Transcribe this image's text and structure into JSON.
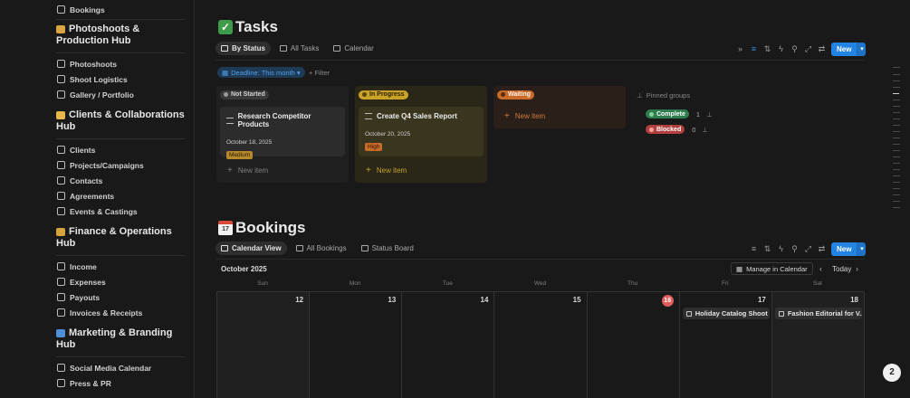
{
  "sidebar": {
    "top_item": "Bookings",
    "hubs": [
      {
        "title": "Photoshoots & Production Hub",
        "icon": "camera-emoji-icon",
        "color": "#d9a441",
        "items": [
          "Photoshoots",
          "Shoot Logistics",
          "Gallery / Portfolio"
        ]
      },
      {
        "title": "Clients & Collaborations Hub",
        "icon": "handshake-emoji-icon",
        "color": "#e6b84c",
        "items": [
          "Clients",
          "Projects/Campaigns",
          "Contacts",
          "Agreements",
          "Events & Castings"
        ]
      },
      {
        "title": "Finance & Operations Hub",
        "icon": "money-bag-emoji-icon",
        "color": "#d6a23c",
        "items": [
          "Income",
          "Expenses",
          "Payouts",
          "Invoices & Receipts"
        ]
      },
      {
        "title": "Marketing & Branding Hub",
        "icon": "megaphone-emoji-icon",
        "color": "#4f8fd9",
        "items": [
          "Social Media Calendar",
          "Press & PR"
        ]
      }
    ]
  },
  "tasks": {
    "title": "Tasks",
    "tabs": [
      "By Status",
      "All Tasks",
      "Calendar"
    ],
    "new_label": "New",
    "filter_chip": "Deadline: This month",
    "filter_add": "Filter",
    "columns": [
      {
        "status": "Not Started",
        "pill_bg": "#3a3a3a",
        "pill_fg": "#d0d0d0",
        "dot": "#9a9a9a",
        "card": {
          "title": "Research Competitor Products",
          "date": "October 18, 2025",
          "priority": "Medium",
          "pr_bg": "#b8892c",
          "pr_fg": "#201500"
        },
        "new_item": "New item"
      },
      {
        "status": "In Progress",
        "pill_bg": "#c9a227",
        "pill_fg": "#2a2000",
        "dot": "#5a4300",
        "card": {
          "title": "Create Q4 Sales Report",
          "date": "October 20, 2025",
          "priority": "High",
          "pr_bg": "#c86a2a",
          "pr_fg": "#2a1200"
        },
        "new_item": "New item"
      },
      {
        "status": "Waiting",
        "pill_bg": "#c86a2a",
        "pill_fg": "#fff2e6",
        "dot": "#5a2a00",
        "new_item": "New item"
      }
    ],
    "pinned_label": "Pinned groups",
    "pinned": [
      {
        "label": "Complete",
        "count": "1",
        "bg": "#2f7d4f",
        "dot": "#7fd3a0"
      },
      {
        "label": "Blocked",
        "count": "0",
        "bg": "#b0403d",
        "dot": "#ff9f9c"
      }
    ]
  },
  "bookings": {
    "title": "Bookings",
    "tabs": [
      "Calendar View",
      "All Bookings",
      "Status Board"
    ],
    "new_label": "New",
    "month": "October 2025",
    "manage_label": "Manage in Calendar",
    "today_label": "Today",
    "weekdays": [
      "Sun",
      "Mon",
      "Tue",
      "Wed",
      "Thu",
      "Fri",
      "Sat"
    ],
    "days": [
      "12",
      "13",
      "14",
      "15",
      "16",
      "17",
      "18"
    ],
    "today_index": 4,
    "events": [
      {
        "day_index": 5,
        "title": "Holiday Catalog Shoot"
      },
      {
        "day_index": 6,
        "title": "Fashion Editorial for V..."
      }
    ]
  },
  "scroll_button": "2"
}
